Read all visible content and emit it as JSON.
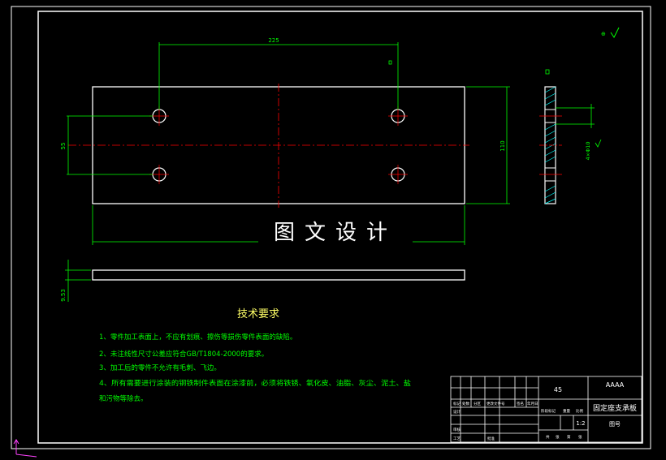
{
  "drawing": {
    "dimensions": {
      "top_span": "225",
      "hole_spacing": "55",
      "height": "110",
      "thickness": "9.53",
      "side_hole": "4×Φ10"
    },
    "watermark": "图文设计",
    "tech_requirements": {
      "title": "技术要求",
      "items": [
        "1、零件加工表面上，不应有划痕、擦伤等损伤零件表面的缺陷。",
        "2、未注线性尺寸公差应符合GB/T1804-2000的要求。",
        "3、加工后的零件不允许有毛刺、飞边。",
        "4、所有需要进行涂装的钢铁制件表面在涂漆前，必须将铁锈、氧化皮、油脂、灰尘、泥土、盐",
        "和污物等除去。"
      ]
    },
    "title_block": {
      "material": "45",
      "company": "AAAA",
      "part_name": "固定座支承板",
      "drawing_no_label": "图号",
      "scale": "1:2",
      "row_labels": [
        "标记",
        "处数",
        "分区",
        "更改文件号",
        "签名",
        "年月日"
      ],
      "small_labels": [
        "设计",
        "审核",
        "工艺",
        "批准"
      ],
      "bottom_labels": [
        "共",
        "张",
        "第",
        "张"
      ],
      "stage_labels": [
        "阶段标记",
        "重量",
        "比例"
      ]
    },
    "colors": {
      "frame": "#ffffff",
      "dimension": "#00ff00",
      "centerline": "#ff0000",
      "hatch": "#00ffff",
      "text_green": "#00ff00",
      "text_yellow": "#ffff66"
    }
  }
}
